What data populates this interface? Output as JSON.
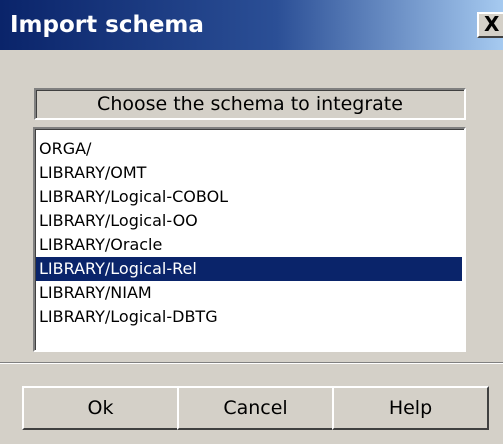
{
  "window": {
    "title": "Import schema",
    "close_label": "X"
  },
  "heading": "Choose the schema to integrate",
  "list": {
    "items": [
      "ORGA/",
      "LIBRARY/OMT",
      "LIBRARY/Logical-COBOL",
      "LIBRARY/Logical-OO",
      "LIBRARY/Oracle",
      "LIBRARY/Logical-Rel",
      "LIBRARY/NIAM",
      "LIBRARY/Logical-DBTG"
    ],
    "selected": "LIBRARY/Logical-Rel"
  },
  "buttons": {
    "ok": "Ok",
    "cancel": "Cancel",
    "help": "Help"
  },
  "colors": {
    "titlebar": "#0a246a",
    "selection": "#0a246a",
    "face": "#d4d0c8"
  }
}
